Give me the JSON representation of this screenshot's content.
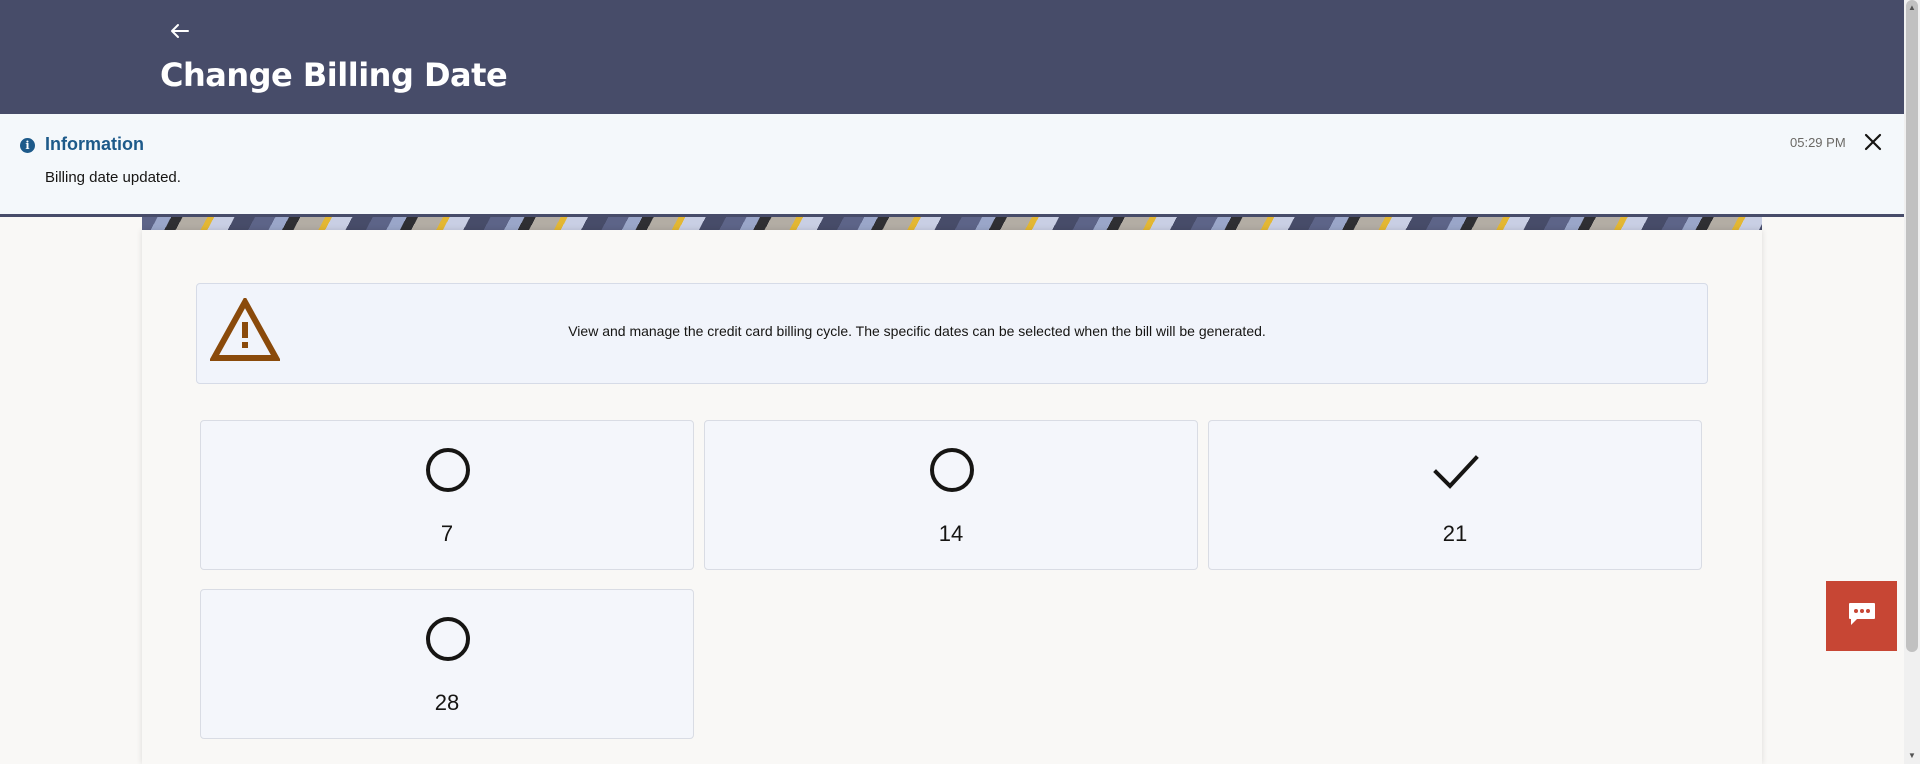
{
  "header": {
    "title": "Change Billing Date",
    "back_icon": "arrow-left-icon"
  },
  "notification": {
    "title": "Information",
    "message": "Billing date updated.",
    "time": "05:29 PM",
    "icon": "info-icon",
    "close_icon": "close-icon"
  },
  "alert": {
    "icon": "warning-icon",
    "text": "View and manage the credit card billing cycle. The specific dates can be selected when the bill will be generated."
  },
  "billing_dates": [
    {
      "label": "7",
      "selected": false
    },
    {
      "label": "14",
      "selected": false
    },
    {
      "label": "21",
      "selected": true
    },
    {
      "label": "28",
      "selected": false
    }
  ],
  "chat": {
    "icon": "chat-icon"
  },
  "colors": {
    "header_bg": "#474c69",
    "info_accent": "#1d5a8a",
    "warning": "#8a4a0b",
    "chat_bg": "#c74634"
  }
}
